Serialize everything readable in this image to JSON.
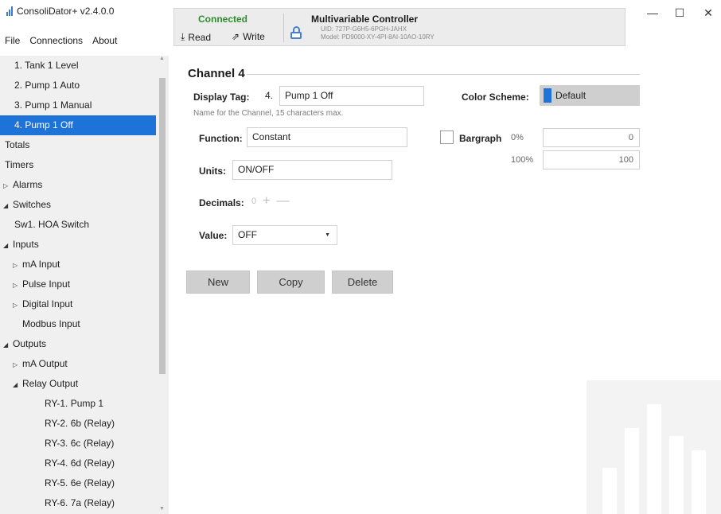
{
  "app": {
    "title": "ConsoliDator+ v2.4.0.0",
    "menu": [
      "File",
      "Connections",
      "About"
    ]
  },
  "status": {
    "connection": "Connected",
    "read_label": "Read",
    "write_label": "Write",
    "device_title": "Multivariable Controller",
    "uid": "UID: 727P-G6H5-6PGH-JAHX",
    "model": "Model: PD9000-XY-4PI-8AI-10AO-10RY"
  },
  "window_controls": {
    "minimize": "—",
    "maximize": "☐",
    "close": "✕"
  },
  "sidebar": {
    "items": [
      {
        "label": "1. Tank 1 Level",
        "arrow": ""
      },
      {
        "label": "2. Pump 1 Auto",
        "arrow": ""
      },
      {
        "label": "3. Pump 1 Manual",
        "arrow": ""
      },
      {
        "label": "4. Pump 1 Off",
        "arrow": ""
      },
      {
        "label": "Totals",
        "arrow": ""
      },
      {
        "label": "Timers",
        "arrow": ""
      },
      {
        "label": "Alarms",
        "arrow": "▷"
      },
      {
        "label": "Switches",
        "arrow": "◢"
      },
      {
        "label": "Sw1. HOA Switch",
        "arrow": ""
      },
      {
        "label": "Inputs",
        "arrow": "◢"
      },
      {
        "label": "mA Input",
        "arrow": "▷"
      },
      {
        "label": "Pulse Input",
        "arrow": "▷"
      },
      {
        "label": "Digital Input",
        "arrow": "▷"
      },
      {
        "label": "Modbus Input",
        "arrow": ""
      },
      {
        "label": "Outputs",
        "arrow": "◢"
      },
      {
        "label": "mA Output",
        "arrow": "▷"
      },
      {
        "label": "Relay Output",
        "arrow": "◢"
      },
      {
        "label": "RY-1. Pump 1",
        "arrow": ""
      },
      {
        "label": "RY-2. 6b (Relay)",
        "arrow": ""
      },
      {
        "label": "RY-3. 6c (Relay)",
        "arrow": ""
      },
      {
        "label": "RY-4. 6d (Relay)",
        "arrow": ""
      },
      {
        "label": "RY-5. 6e (Relay)",
        "arrow": ""
      },
      {
        "label": "RY-6. 7a (Relay)",
        "arrow": ""
      }
    ],
    "selected_index": 3
  },
  "channel": {
    "title": "Channel 4",
    "display_tag_label": "Display Tag:",
    "tag_number": "4.",
    "tag_value": "Pump 1 Off",
    "hint": "Name for the Channel, 15 characters max.",
    "color_scheme_label": "Color Scheme:",
    "color_scheme_value": "Default",
    "color_scheme_swatch": "#1e73d8",
    "function_label": "Function:",
    "function_value": "Constant",
    "bargraph_label": "Bargraph",
    "bargraph_checked": false,
    "bar_0_label": "0%",
    "bar_0_value": "0",
    "bar_100_label": "100%",
    "bar_100_value": "100",
    "units_label": "Units:",
    "units_value": "ON/OFF",
    "decimals_label": "Decimals:",
    "decimals_value": "0",
    "stepper_plus": "+",
    "stepper_minus": "—",
    "value_label": "Value:",
    "value_selected": "OFF",
    "buttons": {
      "new": "New",
      "copy": "Copy",
      "delete": "Delete"
    }
  }
}
